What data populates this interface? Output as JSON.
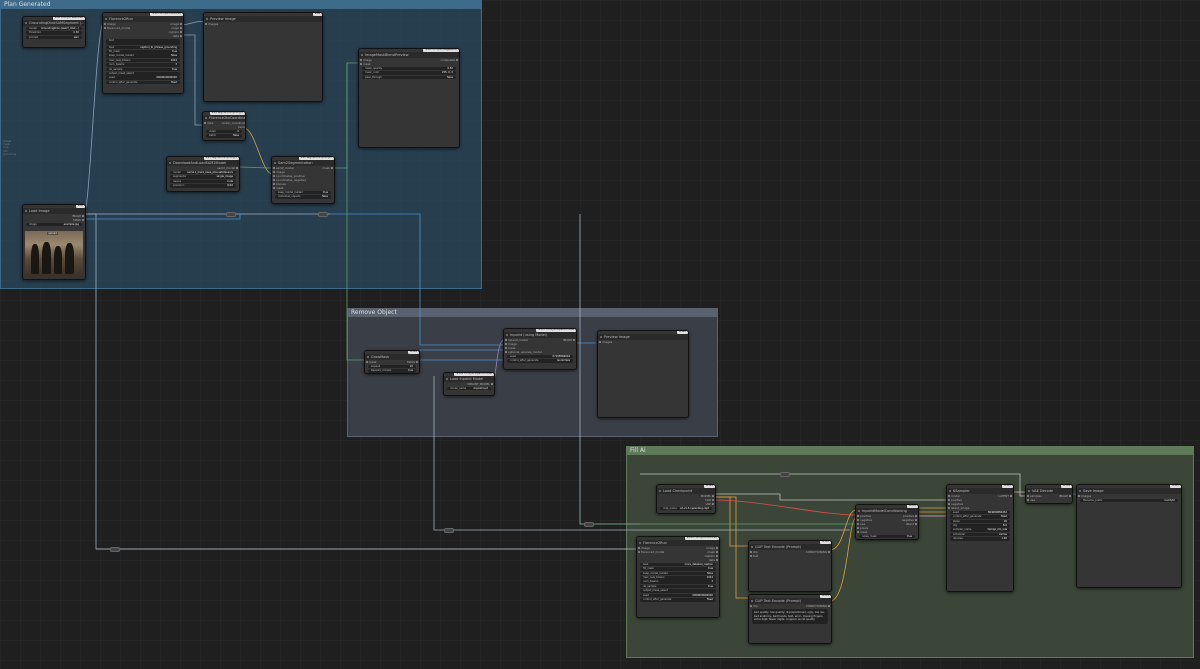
{
  "groups": {
    "top": {
      "title": "Plan Generated",
      "color": "#2b4a60",
      "border": "#3f6b8a"
    },
    "remove": {
      "title": "Remove Object",
      "color": "#3d434b",
      "border": "#5a6270"
    },
    "fill": {
      "title": "Fill Ai",
      "color": "#3e4a3b",
      "border": "#5f7a58"
    }
  },
  "side_note": [
    "image",
    "mask",
    "crop",
    "info",
    "grounding"
  ],
  "nodes": {
    "groundingdino": {
      "title": "GroundingDinoSAMSegment (...)",
      "badge": "#56 comfyui-Resolved",
      "io_in": [
        "sam_model",
        "grounding_dino_model"
      ],
      "widgets": [
        [
          "model",
          "GroundingDino (swinT_OGC...)"
        ],
        [
          "threshold",
          "0.30"
        ],
        [
          "prompt",
          "sam"
        ]
      ]
    },
    "florence_run": {
      "title": "Florence2Run",
      "badge": "#50 comfyui-florence2",
      "io_in": [
        "image",
        "florence2_model"
      ],
      "io_out": [
        "image",
        "mask",
        "caption",
        "data"
      ],
      "widgets": [
        [
          "text",
          ""
        ],
        [
          "task",
          "caption_to_phrase_grounding"
        ],
        [
          "fill_mask",
          "true"
        ],
        [
          "keep_model_loaded",
          "false"
        ],
        [
          "max_new_tokens",
          "1024"
        ],
        [
          "num_beams",
          "3"
        ],
        [
          "do_sample",
          "true"
        ],
        [
          "output_mask_select",
          ""
        ],
        [
          "seed",
          "0000000000000"
        ],
        [
          "control_after_generate",
          "fixed"
        ]
      ]
    },
    "preview_top": {
      "title": "Preview Image",
      "badge": "#69",
      "io_in": [
        "images"
      ]
    },
    "florence_coords": {
      "title": "Florence2toCoordinates",
      "badge": "#64 segment-anything-2",
      "io_in": [
        "data"
      ],
      "io_out": [
        "center_coordinates",
        "bboxes"
      ],
      "widgets": [
        [
          "index",
          "0"
        ],
        [
          "batch",
          "false"
        ]
      ]
    },
    "download_sam2": {
      "title": "DownloadAndLoadSAM2Model",
      "badge": "#63 segment-anything-2",
      "io_out": [
        "sam2_model"
      ],
      "widgets": [
        [
          "model",
          "sam2.1_hiera_base_plus.safetensors"
        ],
        [
          "segmentor",
          "single_image"
        ],
        [
          "device",
          "cuda"
        ],
        [
          "precision",
          "fp16"
        ]
      ]
    },
    "sam2_segmentation": {
      "title": "Sam2Segmentation",
      "badge": "#62 segment-anything-2",
      "io_in": [
        "sam2_model",
        "image",
        "coordinates_positive",
        "coordinates_negative",
        "bboxes",
        "mask"
      ],
      "io_out": [
        "mask"
      ],
      "widgets": [
        [
          "keep_model_loaded",
          "true"
        ],
        [
          "individual_objects",
          "false"
        ]
      ]
    },
    "load_image": {
      "title": "Load Image",
      "badge": "#82",
      "io_out": [
        "IMAGE",
        "MASK"
      ],
      "widgets": [
        [
          "image",
          "example.jpg"
        ]
      ],
      "photo_label": "upload"
    },
    "image_blend_mask": {
      "title": "ImageMaskBlendPreview",
      "badge": "#46 comfyui-imageblend",
      "io_in": [
        "image",
        "mask"
      ],
      "io_out": [
        "composite"
      ],
      "widgets": [
        [
          "mask_opacity",
          "0.50"
        ],
        [
          "mask_color",
          "255, 0, 0"
        ],
        [
          "pass_through",
          "false"
        ]
      ]
    },
    "grow_mask": {
      "title": "GrowMask",
      "badge": "#118",
      "io_in": [
        "mask"
      ],
      "io_out": [
        "MASK"
      ],
      "widgets": [
        [
          "expand",
          "20"
        ],
        [
          "tapered_corners",
          "true"
        ]
      ]
    },
    "load_inpaint": {
      "title": "Load Inpaint Model",
      "badge": "#116 comfyui-inpaint-nodes",
      "io_out": [
        "INPAINT_MODEL"
      ],
      "widgets": [
        [
          "model_name",
          "big-lama.pt"
        ]
      ]
    },
    "inpaint_using": {
      "title": "Inpaint (using Model)",
      "badge": "#117 comfyui-inpaint-nodes",
      "io_in": [
        "inpaint_model",
        "image",
        "mask",
        "optional_upscale_model"
      ],
      "io_out": [
        "IMAGE"
      ],
      "widgets": [
        [
          "seed",
          "07188566644"
        ],
        [
          "control_after_generate",
          "randomize"
        ]
      ]
    },
    "preview_remove": {
      "title": "Preview Image",
      "badge": "#120",
      "io_in": [
        "images"
      ]
    },
    "load_checkpoint": {
      "title": "Load Checkpoint",
      "badge": "#129",
      "io_out": [
        "MODEL",
        "CLIP",
        "VAE"
      ],
      "widgets": [
        [
          "ckpt_name",
          "sd-v1-5-inpainting.ckpt"
        ]
      ]
    },
    "florence_fill": {
      "title": "Florence2Run",
      "badge": "#128 comfyui-florence2",
      "io_in": [
        "image",
        "florence2_model"
      ],
      "io_out": [
        "image",
        "mask",
        "caption",
        "data"
      ],
      "widgets": [
        [
          "task",
          "more_detailed_caption"
        ],
        [
          "fill_mask",
          "true"
        ],
        [
          "keep_model_loaded",
          "false"
        ],
        [
          "max_new_tokens",
          "1024"
        ],
        [
          "num_beams",
          "3"
        ],
        [
          "do_sample",
          "true"
        ],
        [
          "output_mask_select",
          ""
        ],
        [
          "seed",
          "0000000000000"
        ],
        [
          "control_after_generate",
          "fixed"
        ]
      ]
    },
    "clip_pos": {
      "title": "CLIP Text Encode (Prompt)",
      "badge": "#130",
      "io_in": [
        "clip",
        "text"
      ],
      "io_out": [
        "CONDITIONING"
      ]
    },
    "clip_neg": {
      "title": "CLIP Text Encode (Prompt)",
      "badge": "#131",
      "io_in": [
        "clip"
      ],
      "io_out": [
        "CONDITIONING"
      ],
      "text": "bad quality, low quality, ill-proportioned, ugly, low res, bad anatomy, bad hands, text, error, missing fingers, extra digit, fewer digits, cropped, worst quality"
    },
    "inpaint_cond": {
      "title": "InpaintModelConditioning",
      "badge": "#132",
      "io_in": [
        "positive",
        "negative",
        "vae",
        "pixels",
        "mask"
      ],
      "io_out": [
        "positive",
        "negative",
        "latent"
      ],
      "widgets": [
        [
          "noise_mask",
          "true"
        ]
      ]
    },
    "ksampler": {
      "title": "KSampler",
      "badge": "#133",
      "io_in": [
        "model",
        "positive",
        "negative",
        "latent_image"
      ],
      "io_out": [
        "LATENT"
      ],
      "widgets": [
        [
          "seed",
          "864689684432"
        ],
        [
          "control_after_generate",
          "fixed"
        ],
        [
          "steps",
          "20"
        ],
        [
          "cfg",
          "8.0"
        ],
        [
          "sampler_name",
          "dpmpp_2m_sde"
        ],
        [
          "scheduler",
          "karras"
        ],
        [
          "denoise",
          "1.00"
        ]
      ]
    },
    "vae_decode": {
      "title": "VAE Decode",
      "badge": "#134",
      "io_in": [
        "samples",
        "vae"
      ],
      "io_out": [
        "IMAGE"
      ]
    },
    "save_image": {
      "title": "Save Image",
      "badge": "#135",
      "io_in": [
        "images"
      ],
      "widgets": [
        [
          "filename_prefix",
          "ComfyUI"
        ]
      ]
    }
  }
}
